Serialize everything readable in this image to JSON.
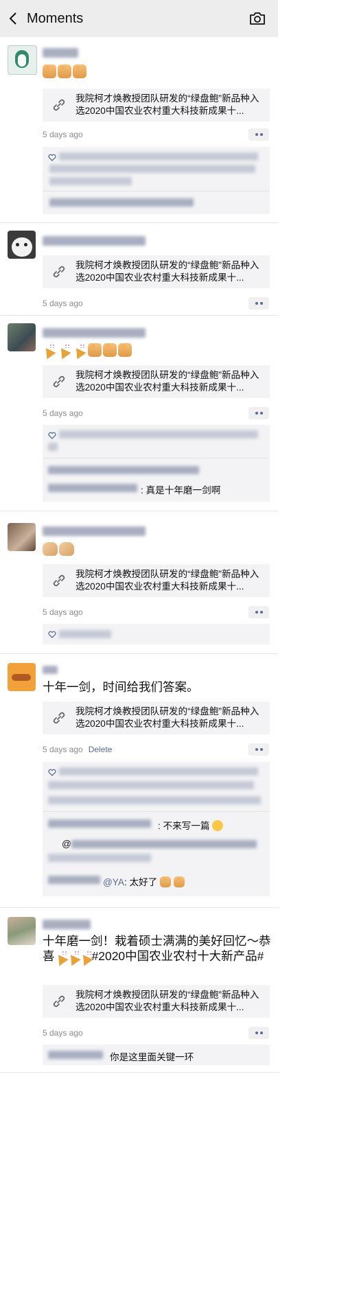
{
  "header": {
    "title": "Moments"
  },
  "link_title": "我院柯才焕教授团队研发的“绿盘鲍”新品种入选2020中国农业农村重大科技新成果十...",
  "time": "5 days ago",
  "delete_label": "Delete",
  "posts": [
    {
      "text": ""
    },
    {
      "text": ""
    },
    {
      "text": "",
      "comment_tail": ": 真是十年磨一剑啊"
    },
    {
      "text": ""
    },
    {
      "text": "十年一剑，时间给我们答案。",
      "comment1_tail": ": 不来写一篇",
      "comment2_prefix": "@",
      "comment3_mention": "@YA",
      "comment3_tail": ": 太好了"
    },
    {
      "text": "十年磨一剑！栽着硕士满满的美好回忆～恭喜",
      "text_hashtag": "#2020中国农业农村十大新产品#",
      "comment_tail": "你是这里面关键一环"
    }
  ],
  "colors": {
    "header_bg": "#ededed",
    "link_blue": "#576b95",
    "card_bg": "#f3f3f5"
  },
  "icons": [
    "back-arrow-icon",
    "camera-icon",
    "link-icon",
    "heart-icon",
    "more-dots-icon",
    "thumbs-up-icon",
    "party-popper-icon",
    "clapping-hands-icon",
    "woozy-face-icon"
  ]
}
